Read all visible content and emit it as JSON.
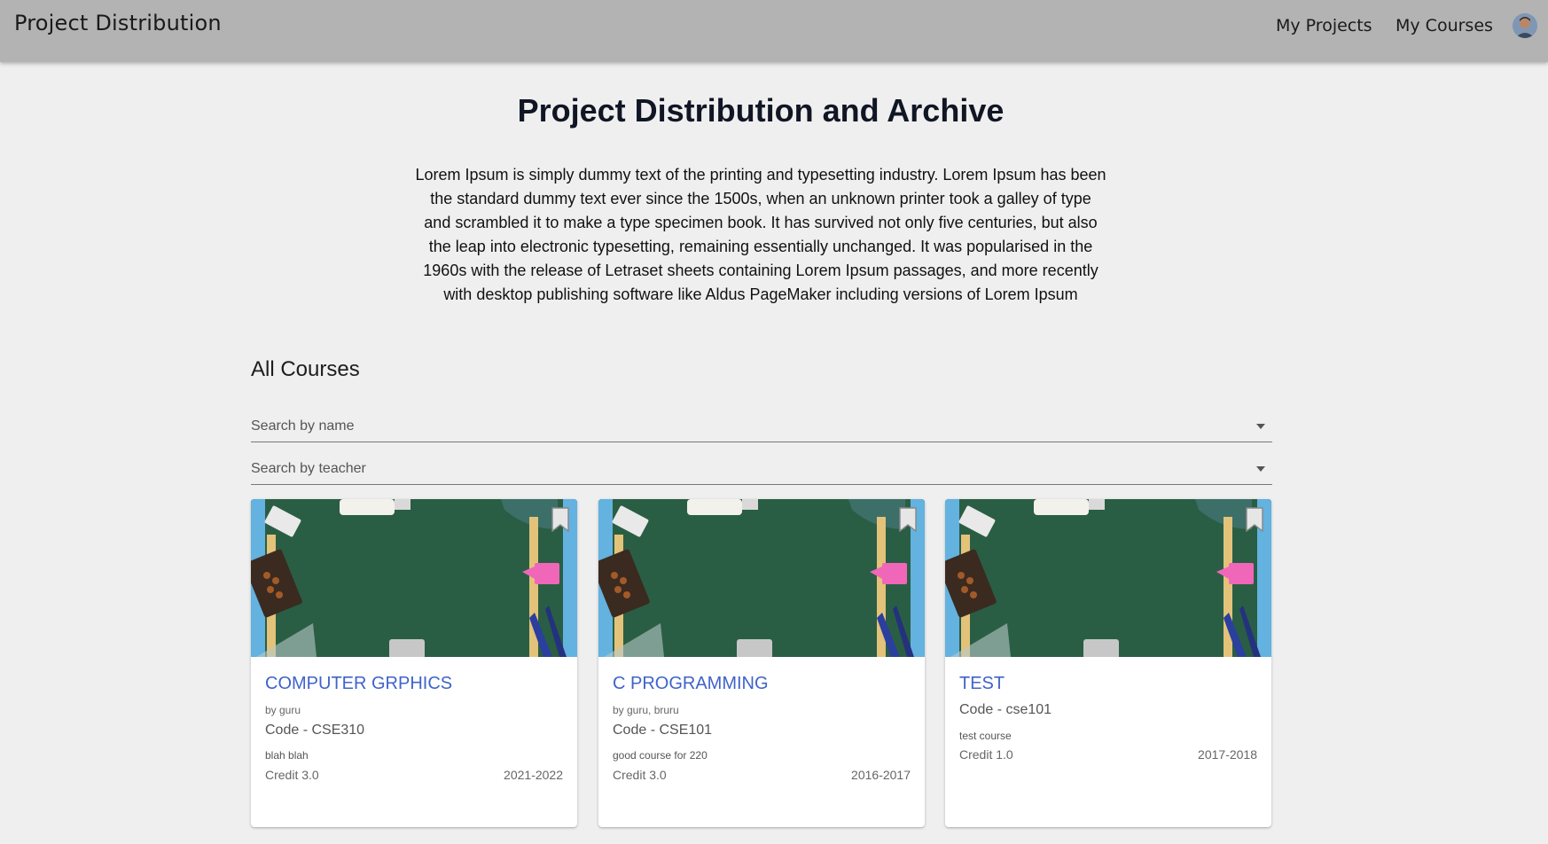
{
  "header": {
    "brand": "Project Distribution",
    "nav": [
      "My Projects",
      "My Courses"
    ]
  },
  "hero": {
    "title": "Project Distribution and Archive",
    "description": "Lorem Ipsum is simply dummy text of the printing and typesetting industry. Lorem Ipsum has been the standard dummy text ever since the 1500s, when an unknown printer took a galley of type and scrambled it to make a type specimen book. It has survived not only five centuries, but also the leap into electronic typesetting, remaining essentially unchanged. It was popularised in the 1960s with the release of Letraset sheets containing Lorem Ipsum passages, and more recently with desktop publishing software like Aldus PageMaker including versions of Lorem Ipsum"
  },
  "courses": {
    "section_title": "All Courses",
    "filters": {
      "name_placeholder": "Search by name",
      "teacher_placeholder": "Search by teacher"
    },
    "cards": [
      {
        "title": "COMPUTER GRPHICS",
        "teachers": "by guru",
        "code": "Code - CSE310",
        "about": "blah blah",
        "credit": "Credit 3.0",
        "session": "2021-2022"
      },
      {
        "title": "C PROGRAMMING",
        "teachers": "by guru, bruru",
        "code": "Code - CSE101",
        "about": "good course for 220",
        "credit": "Credit 3.0",
        "session": "2016-2017"
      },
      {
        "title": "TEST",
        "teachers": "",
        "code": "Code - cse101",
        "about": "test course",
        "credit": "Credit 1.0",
        "session": "2017-2018"
      }
    ]
  },
  "icons": {
    "avatar": "user-avatar",
    "bookmark": "bookmark-icon",
    "dropdown": "chevron-down-icon"
  },
  "colors": {
    "header_bg": "#b3b3b3",
    "page_bg": "#efefef",
    "card_title": "#3f63c9",
    "chalkboard": "#2a5e44"
  }
}
